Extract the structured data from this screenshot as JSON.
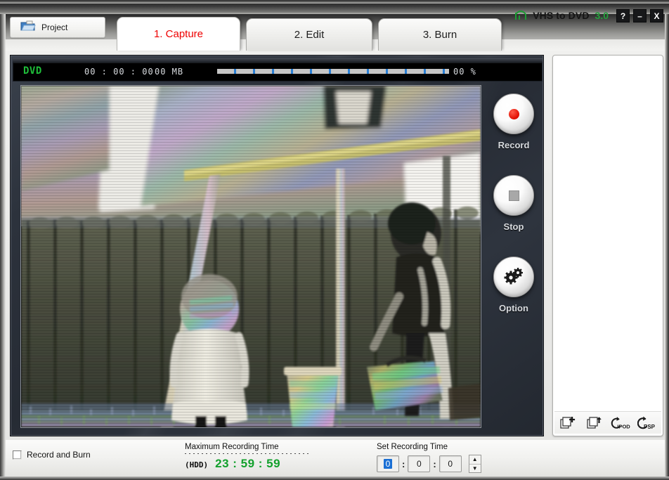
{
  "window": {
    "brand_name": "VHS to DVD",
    "brand_version": "3.0",
    "logo_icon": "arc-logo-icon",
    "help_label": "?",
    "minimize_label": "–",
    "close_label": "X"
  },
  "toolbar": {
    "project_label": "Project",
    "project_icon": "folder-icon"
  },
  "tabs": [
    {
      "label": "1. Capture",
      "active": true
    },
    {
      "label": "2. Edit",
      "active": false
    },
    {
      "label": "3. Burn",
      "active": false
    }
  ],
  "status": {
    "mode": "DVD",
    "elapsed": "00 : 00 : 00",
    "size": "00 MB",
    "percent": "00 %",
    "progress_value": 0,
    "accent_green": "#1fbe3a",
    "progress_segment_color": "#c6c6c6",
    "progress_divider_color": "#2a7fd4"
  },
  "preview": {
    "description": "VHS capture frame: two children in a backyard near a wooden fence and swing set, with rainbow chroma artifacts"
  },
  "controls": [
    {
      "label": "Record",
      "icon": "record-dot-icon"
    },
    {
      "label": "Stop",
      "icon": "stop-square-icon"
    },
    {
      "label": "Option",
      "icon": "gears-icon"
    }
  ],
  "file_panel": {
    "items": [],
    "tools": [
      {
        "name": "add-file-icon",
        "label": ""
      },
      {
        "name": "export-file-icon",
        "label": ""
      },
      {
        "name": "ipod-convert-icon",
        "label": "IPOD"
      },
      {
        "name": "psp-convert-icon",
        "label": "PSP"
      }
    ]
  },
  "bottom": {
    "record_and_burn_label": "Record and Burn",
    "record_and_burn_checked": false,
    "max_recording_time_label": "Maximum Recording Time",
    "max_recording_source": "(HDD)",
    "max_recording_value": "23 : 59 : 59",
    "set_recording_time_label": "Set Recording Time",
    "set_hours": "0",
    "set_minutes": "0",
    "set_seconds": "0",
    "separator": ":",
    "spinner_up": "▲",
    "spinner_down": "▼"
  }
}
